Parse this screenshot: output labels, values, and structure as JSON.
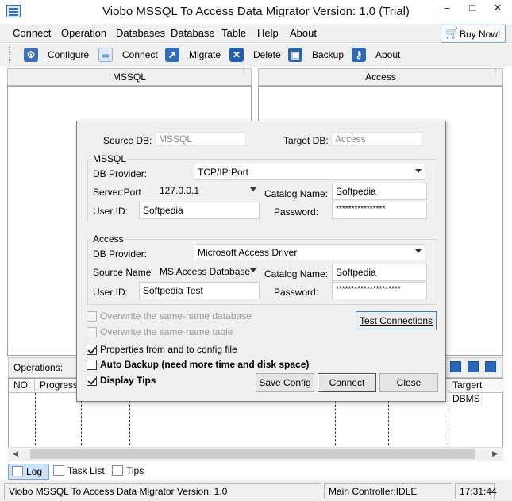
{
  "window": {
    "title": "Viobo MSSQL To Access Data Migrator Version: 1.0  (Trial)",
    "controls": {
      "minimize": "–",
      "maximize": "□",
      "close": "✕"
    }
  },
  "menu": [
    "Connect",
    "Operation",
    "Databases",
    "Database",
    "Table",
    "Help",
    "About"
  ],
  "buy_now": "Buy Now!",
  "toolbar": [
    {
      "label": "Configure",
      "icon": "gear-icon",
      "color": "#3b6fb6"
    },
    {
      "label": "Connect",
      "icon": "chain-link-icon",
      "color": "#2f7cc0"
    },
    {
      "label": "Migrate",
      "icon": "migrate-arrow-icon",
      "color": "#2f6db5"
    },
    {
      "label": "Delete",
      "icon": "delete-x-icon",
      "color": "#1f5fb0"
    },
    {
      "label": "Backup",
      "icon": "floppy-disk-icon",
      "color": "#2c63ad"
    },
    {
      "label": "About",
      "icon": "key-icon",
      "color": "#2d68b2"
    }
  ],
  "panels": {
    "left": "MSSQL",
    "right": "Access"
  },
  "operations": {
    "label": "Operations:",
    "columns": [
      "NO.",
      "Progress",
      "",
      "",
      "",
      "",
      "",
      "Targert DBMS"
    ]
  },
  "tabs": [
    {
      "label": "Log",
      "icon": "log-icon"
    },
    {
      "label": "Task List",
      "icon": "task-list-icon"
    },
    {
      "label": "Tips",
      "icon": "tips-icon"
    }
  ],
  "statusbar": {
    "app": "Viobo MSSQL To Access Data Migrator Version: 1.0",
    "controller": "Main Controller:IDLE",
    "time": "17:31:44"
  },
  "dialog": {
    "source_db_label": "Source DB:",
    "source_db_value": "MSSQL",
    "target_db_label": "Target DB:",
    "target_db_value": "Access",
    "mssql": {
      "group": "MSSQL",
      "provider_label": "DB Provider:",
      "provider_value": "TCP/IP:Port",
      "server_label": "Server:Port",
      "server_value": "127.0.0.1",
      "catalog_label": "Catalog Name:",
      "catalog_value": "Softpedia",
      "user_label": "User ID:",
      "user_value": "Softpedia",
      "password_label": "Password:",
      "password_value": "****************"
    },
    "access": {
      "group": "Access",
      "provider_label": "DB Provider:",
      "provider_value": "Microsoft Access Driver",
      "source_label": "Source Name",
      "source_value": "MS Access Database",
      "catalog_label": "Catalog Name:",
      "catalog_value": "Softpedia",
      "user_label": "User ID:",
      "user_value": "Softpedia Test",
      "password_label": "Password:",
      "password_value": "*********************"
    },
    "options": {
      "overwrite_db": {
        "label": "Overwrite the same-name database",
        "checked": false,
        "enabled": false
      },
      "overwrite_table": {
        "label": "Overwrite the same-name table",
        "checked": false,
        "enabled": false
      },
      "properties": {
        "label": "Properties from and to config file",
        "checked": true,
        "enabled": true
      },
      "auto_backup": {
        "label": "Auto Backup (need more time and disk space)",
        "checked": false,
        "enabled": true
      },
      "display_tips": {
        "label": "Display Tips",
        "checked": true,
        "enabled": true
      }
    },
    "buttons": {
      "test": "Test Connections",
      "save": "Save Config",
      "connect": "Connect",
      "close": "Close"
    }
  }
}
